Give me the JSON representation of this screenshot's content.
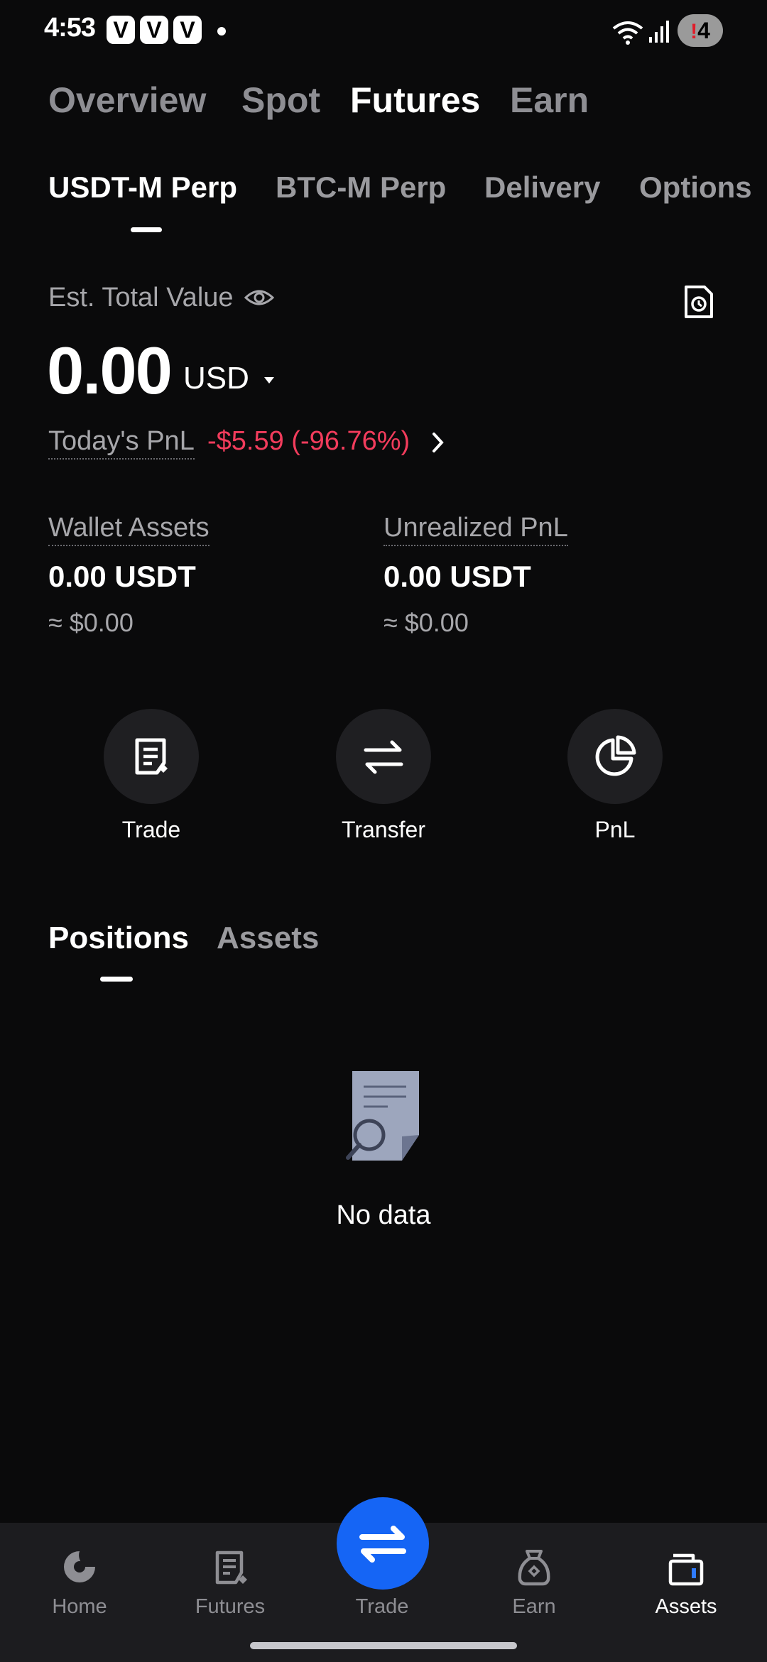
{
  "status_bar": {
    "time": "4:53",
    "badges": [
      "V",
      "V",
      "V"
    ],
    "battery_alert": "!",
    "battery_level": "4"
  },
  "top_tabs": [
    "Overview",
    "Spot",
    "Futures",
    "Earn"
  ],
  "top_tab_active": "Futures",
  "sub_tabs": [
    "USDT-M Perp",
    "BTC-M Perp",
    "Delivery",
    "Options"
  ],
  "sub_tab_active": "USDT-M Perp",
  "summary": {
    "est_label": "Est. Total Value",
    "total_value": "0.00",
    "currency": "USD",
    "pnl_label": "Today's PnL",
    "pnl_value": "-$5.59 (-96.76%)"
  },
  "stats": [
    {
      "label": "Wallet Assets",
      "value": "0.00 USDT",
      "sub": "≈ $0.00"
    },
    {
      "label": "Unrealized PnL",
      "value": "0.00 USDT",
      "sub": "≈ $0.00"
    }
  ],
  "actions": [
    {
      "label": "Trade",
      "icon": "trade-icon"
    },
    {
      "label": "Transfer",
      "icon": "transfer-icon"
    },
    {
      "label": "PnL",
      "icon": "pie-chart-icon"
    }
  ],
  "position_tabs": [
    "Positions",
    "Assets"
  ],
  "position_tab_active": "Positions",
  "empty_state": "No data",
  "bottom_nav": [
    {
      "label": "Home",
      "icon": "home-icon"
    },
    {
      "label": "Futures",
      "icon": "futures-icon"
    },
    {
      "label": "Trade",
      "icon": "trade-swap-icon"
    },
    {
      "label": "Earn",
      "icon": "earn-icon"
    },
    {
      "label": "Assets",
      "icon": "wallet-icon"
    }
  ],
  "bottom_nav_active": "Assets",
  "colors": {
    "background": "#0a0a0b",
    "negative": "#f23c5c",
    "accent": "#1565f5",
    "muted": "#8e8e93"
  }
}
